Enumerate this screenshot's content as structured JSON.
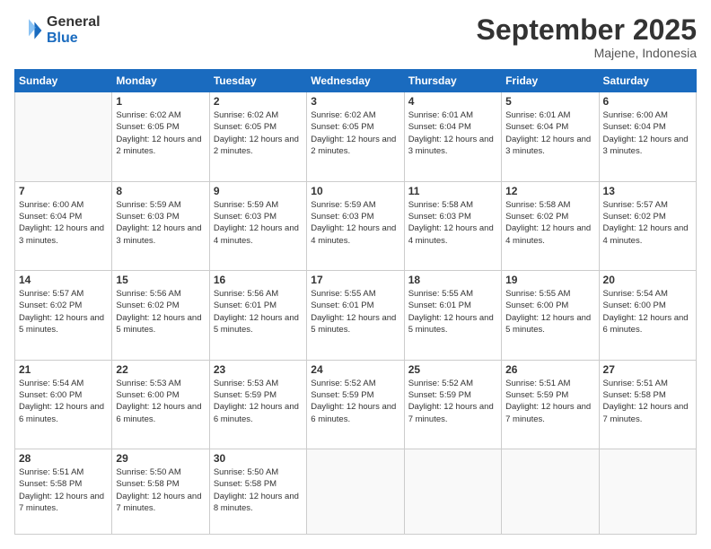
{
  "logo": {
    "general": "General",
    "blue": "Blue"
  },
  "title": "September 2025",
  "location": "Majene, Indonesia",
  "header_days": [
    "Sunday",
    "Monday",
    "Tuesday",
    "Wednesday",
    "Thursday",
    "Friday",
    "Saturday"
  ],
  "weeks": [
    [
      null,
      {
        "day": "1",
        "sunrise": "6:02 AM",
        "sunset": "6:05 PM",
        "daylight": "12 hours and 2 minutes."
      },
      {
        "day": "2",
        "sunrise": "6:02 AM",
        "sunset": "6:05 PM",
        "daylight": "12 hours and 2 minutes."
      },
      {
        "day": "3",
        "sunrise": "6:02 AM",
        "sunset": "6:05 PM",
        "daylight": "12 hours and 2 minutes."
      },
      {
        "day": "4",
        "sunrise": "6:01 AM",
        "sunset": "6:04 PM",
        "daylight": "12 hours and 3 minutes."
      },
      {
        "day": "5",
        "sunrise": "6:01 AM",
        "sunset": "6:04 PM",
        "daylight": "12 hours and 3 minutes."
      },
      {
        "day": "6",
        "sunrise": "6:00 AM",
        "sunset": "6:04 PM",
        "daylight": "12 hours and 3 minutes."
      }
    ],
    [
      {
        "day": "7",
        "sunrise": "6:00 AM",
        "sunset": "6:04 PM",
        "daylight": "12 hours and 3 minutes."
      },
      {
        "day": "8",
        "sunrise": "5:59 AM",
        "sunset": "6:03 PM",
        "daylight": "12 hours and 3 minutes."
      },
      {
        "day": "9",
        "sunrise": "5:59 AM",
        "sunset": "6:03 PM",
        "daylight": "12 hours and 4 minutes."
      },
      {
        "day": "10",
        "sunrise": "5:59 AM",
        "sunset": "6:03 PM",
        "daylight": "12 hours and 4 minutes."
      },
      {
        "day": "11",
        "sunrise": "5:58 AM",
        "sunset": "6:03 PM",
        "daylight": "12 hours and 4 minutes."
      },
      {
        "day": "12",
        "sunrise": "5:58 AM",
        "sunset": "6:02 PM",
        "daylight": "12 hours and 4 minutes."
      },
      {
        "day": "13",
        "sunrise": "5:57 AM",
        "sunset": "6:02 PM",
        "daylight": "12 hours and 4 minutes."
      }
    ],
    [
      {
        "day": "14",
        "sunrise": "5:57 AM",
        "sunset": "6:02 PM",
        "daylight": "12 hours and 5 minutes."
      },
      {
        "day": "15",
        "sunrise": "5:56 AM",
        "sunset": "6:02 PM",
        "daylight": "12 hours and 5 minutes."
      },
      {
        "day": "16",
        "sunrise": "5:56 AM",
        "sunset": "6:01 PM",
        "daylight": "12 hours and 5 minutes."
      },
      {
        "day": "17",
        "sunrise": "5:55 AM",
        "sunset": "6:01 PM",
        "daylight": "12 hours and 5 minutes."
      },
      {
        "day": "18",
        "sunrise": "5:55 AM",
        "sunset": "6:01 PM",
        "daylight": "12 hours and 5 minutes."
      },
      {
        "day": "19",
        "sunrise": "5:55 AM",
        "sunset": "6:00 PM",
        "daylight": "12 hours and 5 minutes."
      },
      {
        "day": "20",
        "sunrise": "5:54 AM",
        "sunset": "6:00 PM",
        "daylight": "12 hours and 6 minutes."
      }
    ],
    [
      {
        "day": "21",
        "sunrise": "5:54 AM",
        "sunset": "6:00 PM",
        "daylight": "12 hours and 6 minutes."
      },
      {
        "day": "22",
        "sunrise": "5:53 AM",
        "sunset": "6:00 PM",
        "daylight": "12 hours and 6 minutes."
      },
      {
        "day": "23",
        "sunrise": "5:53 AM",
        "sunset": "5:59 PM",
        "daylight": "12 hours and 6 minutes."
      },
      {
        "day": "24",
        "sunrise": "5:52 AM",
        "sunset": "5:59 PM",
        "daylight": "12 hours and 6 minutes."
      },
      {
        "day": "25",
        "sunrise": "5:52 AM",
        "sunset": "5:59 PM",
        "daylight": "12 hours and 7 minutes."
      },
      {
        "day": "26",
        "sunrise": "5:51 AM",
        "sunset": "5:59 PM",
        "daylight": "12 hours and 7 minutes."
      },
      {
        "day": "27",
        "sunrise": "5:51 AM",
        "sunset": "5:58 PM",
        "daylight": "12 hours and 7 minutes."
      }
    ],
    [
      {
        "day": "28",
        "sunrise": "5:51 AM",
        "sunset": "5:58 PM",
        "daylight": "12 hours and 7 minutes."
      },
      {
        "day": "29",
        "sunrise": "5:50 AM",
        "sunset": "5:58 PM",
        "daylight": "12 hours and 7 minutes."
      },
      {
        "day": "30",
        "sunrise": "5:50 AM",
        "sunset": "5:58 PM",
        "daylight": "12 hours and 8 minutes."
      },
      null,
      null,
      null,
      null
    ]
  ]
}
